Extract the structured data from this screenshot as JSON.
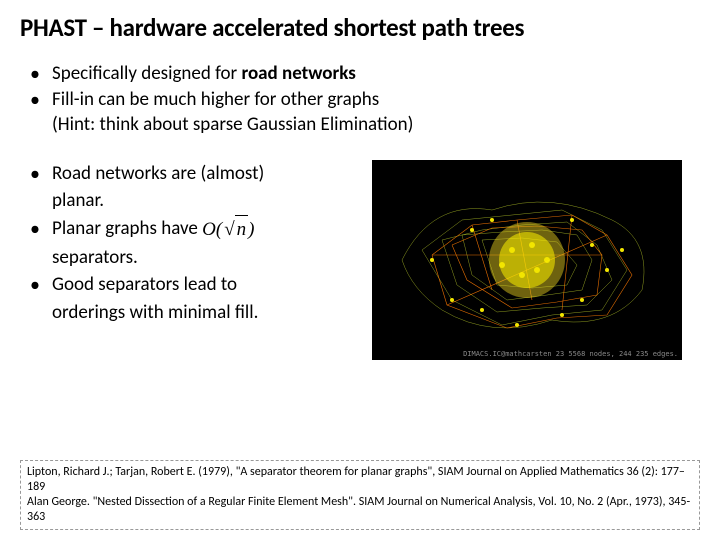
{
  "title": "PHAST – hardware accelerated shortest path trees",
  "top_bullets": {
    "b1_pre": "Specifically designed for ",
    "b1_bold": "road networks",
    "b2": "Fill-in can be much higher for other graphs",
    "hint": "(Hint: think about sparse Gaussian Elimination)"
  },
  "left_bullets": {
    "l1a": "Road networks are (almost)",
    "l1b": "planar.",
    "l2a": "Planar graphs have",
    "l2b": "separators.",
    "l3a": "Good separators lead to",
    "l3b": "orderings with minimal fill."
  },
  "formula": {
    "big_o": "O",
    "open": "(",
    "arg": "n",
    "close": ")"
  },
  "graph_caption": "DIMACS.IC@mathcarsten  23 5568 nodes, 244 235 edges.",
  "references": {
    "r1": "Lipton, Richard J.; Tarjan, Robert E. (1979), \"A separator theorem for planar graphs\", SIAM Journal on Applied Mathematics 36 (2): 177–189",
    "r2": "Alan George. \"Nested Dissection of a Regular Finite Element Mesh\". SIAM Journal on Numerical Analysis, Vol. 10, No. 2 (Apr., 1973), 345-363"
  }
}
